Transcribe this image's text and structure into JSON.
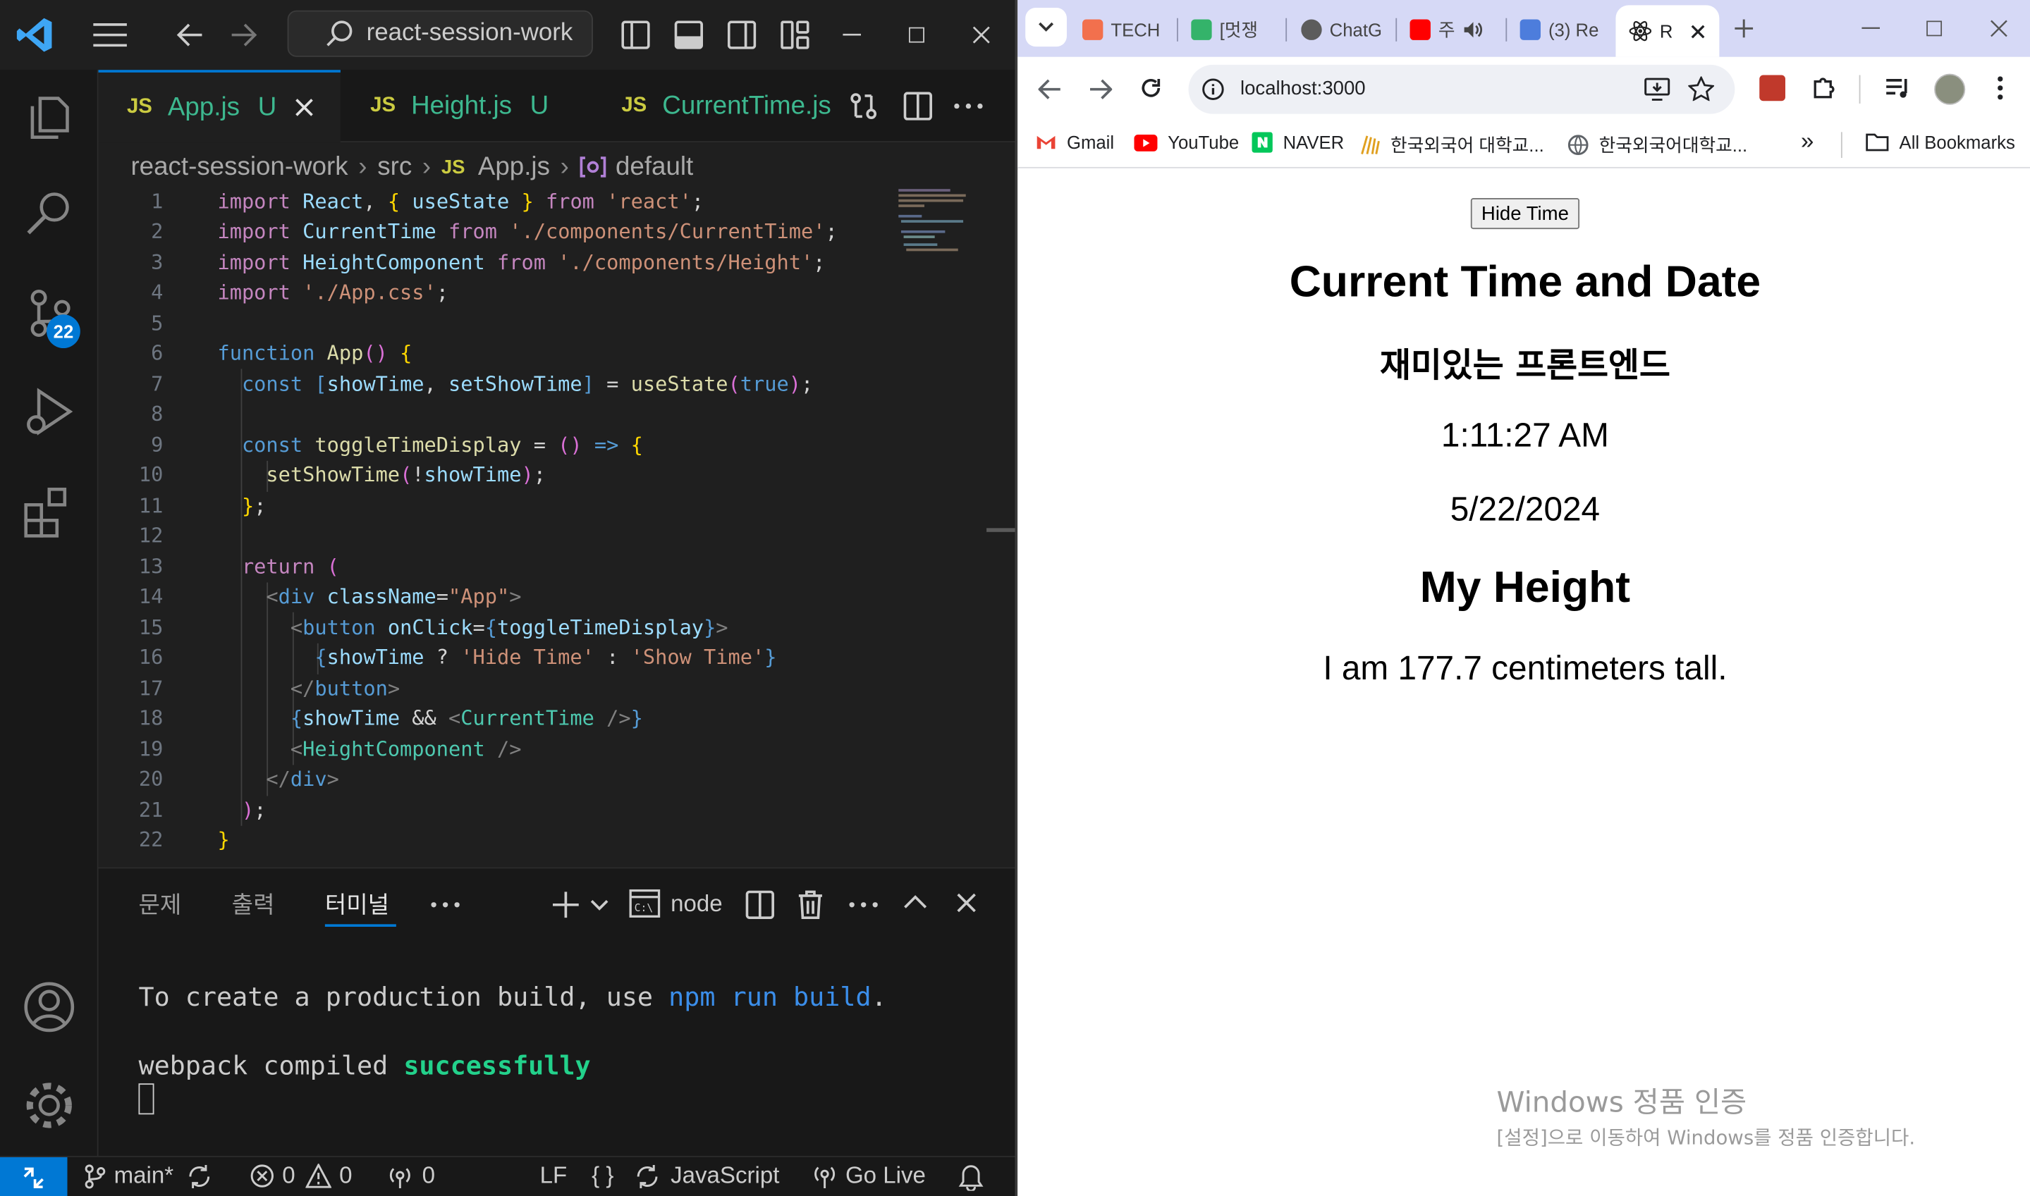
{
  "vscode": {
    "search_text": "react-session-work",
    "badge_count": "22",
    "tabs": [
      {
        "type": "JS",
        "name": "App.js",
        "status": "U"
      },
      {
        "type": "JS",
        "name": "Height.js",
        "status": "U"
      },
      {
        "type": "JS",
        "name": "CurrentTime.js",
        "status": ""
      }
    ],
    "breadcrumb": [
      "react-session-work",
      "src",
      "App.js",
      "default"
    ],
    "breadcrumb_file_icon": "JS",
    "code": [
      "import React, { useState } from 'react';",
      "import CurrentTime from './components/CurrentTime';",
      "import HeightComponent from './components/Height';",
      "import './App.css';",
      "",
      "function App() {",
      "  const [showTime, setShowTime] = useState(true);",
      "",
      "  const toggleTimeDisplay = () => {",
      "    setShowTime(!showTime);",
      "  };",
      "",
      "  return (",
      "    <div className=\"App\">",
      "      <button onClick={toggleTimeDisplay}>",
      "        {showTime ? 'Hide Time' : 'Show Time'}",
      "      </button>",
      "      {showTime && <CurrentTime />}",
      "      <HeightComponent />",
      "    </div>",
      "  );",
      "}"
    ],
    "panel": {
      "tabs": [
        "문제",
        "출력",
        "터미널"
      ],
      "active_tab": "터미널",
      "terminal_name": "node",
      "terminal_lines": [
        {
          "plain": "To create a production build, use ",
          "cmd": "npm run build",
          "end": "."
        },
        {
          "plain": "webpack compiled ",
          "ok": "successfully"
        }
      ]
    },
    "status": {
      "branch": "main*",
      "errors": "0",
      "warnings": "0",
      "ports": "0",
      "eol": "LF",
      "braces": "{ }",
      "language": "JavaScript",
      "go_live": "Go Live"
    }
  },
  "chrome": {
    "tabs": [
      {
        "title": "TECH",
        "color": "#f2704d"
      },
      {
        "title": "[멋쟁",
        "color": "#34b36a"
      },
      {
        "title": "ChatG",
        "color": "#5c5c5c"
      },
      {
        "title": "주",
        "color": "#ff0000"
      },
      {
        "title": "(3) Re",
        "color": "#4d7ddc"
      },
      {
        "title": "R",
        "color": "#222222"
      }
    ],
    "url": "localhost:3000",
    "bookmarks": [
      {
        "label": "Gmail",
        "color": "#ea4335"
      },
      {
        "label": "YouTube",
        "color": "#ff0000"
      },
      {
        "label": "NAVER",
        "color": "#03c75a"
      },
      {
        "label": "한국외국어 대학교...",
        "color": "#e0a020"
      },
      {
        "label": "한국외국어대학교...",
        "color": "#5f6368"
      }
    ],
    "all_bookmarks": "All Bookmarks",
    "more_bookmarks": "»"
  },
  "page": {
    "button_label": "Hide Time",
    "h1": "Current Time and Date",
    "subtitle": "재미있는 프론트엔드",
    "time": "1:11:27 AM",
    "date": "5/22/2024",
    "h2": "My Height",
    "height_text": "I am 177.7 centimeters tall."
  },
  "watermark": {
    "title": "Windows 정품 인증",
    "sub": "[설정]으로 이동하여 Windows를 정품 인증합니다."
  }
}
